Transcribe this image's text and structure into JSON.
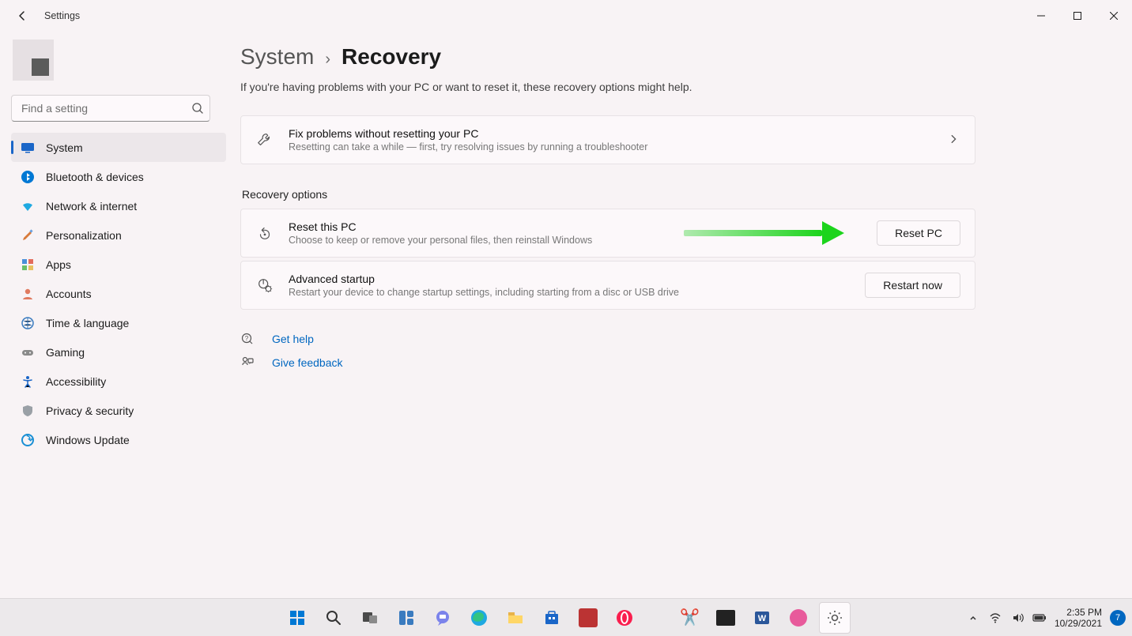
{
  "titlebar": {
    "app_name": "Settings"
  },
  "search": {
    "placeholder": "Find a setting"
  },
  "nav": {
    "items": [
      {
        "label": "System",
        "selected": true
      },
      {
        "label": "Bluetooth & devices"
      },
      {
        "label": "Network & internet"
      },
      {
        "label": "Personalization"
      },
      {
        "label": "Apps"
      },
      {
        "label": "Accounts"
      },
      {
        "label": "Time & language"
      },
      {
        "label": "Gaming"
      },
      {
        "label": "Accessibility"
      },
      {
        "label": "Privacy & security"
      },
      {
        "label": "Windows Update"
      }
    ]
  },
  "breadcrumb": {
    "parent": "System",
    "current": "Recovery"
  },
  "page_subtitle": "If you're having problems with your PC or want to reset it, these recovery options might help.",
  "cards": {
    "troubleshoot": {
      "title": "Fix problems without resetting your PC",
      "sub": "Resetting can take a while — first, try resolving issues by running a troubleshooter"
    },
    "section_label": "Recovery options",
    "reset": {
      "title": "Reset this PC",
      "sub": "Choose to keep or remove your personal files, then reinstall Windows",
      "button": "Reset PC"
    },
    "advanced": {
      "title": "Advanced startup",
      "sub": "Restart your device to change startup settings, including starting from a disc or USB drive",
      "button": "Restart now"
    }
  },
  "help": {
    "get_help": "Get help",
    "feedback": "Give feedback"
  },
  "taskbar": {
    "time": "2:35 PM",
    "date": "10/29/2021",
    "notifications": "7"
  }
}
